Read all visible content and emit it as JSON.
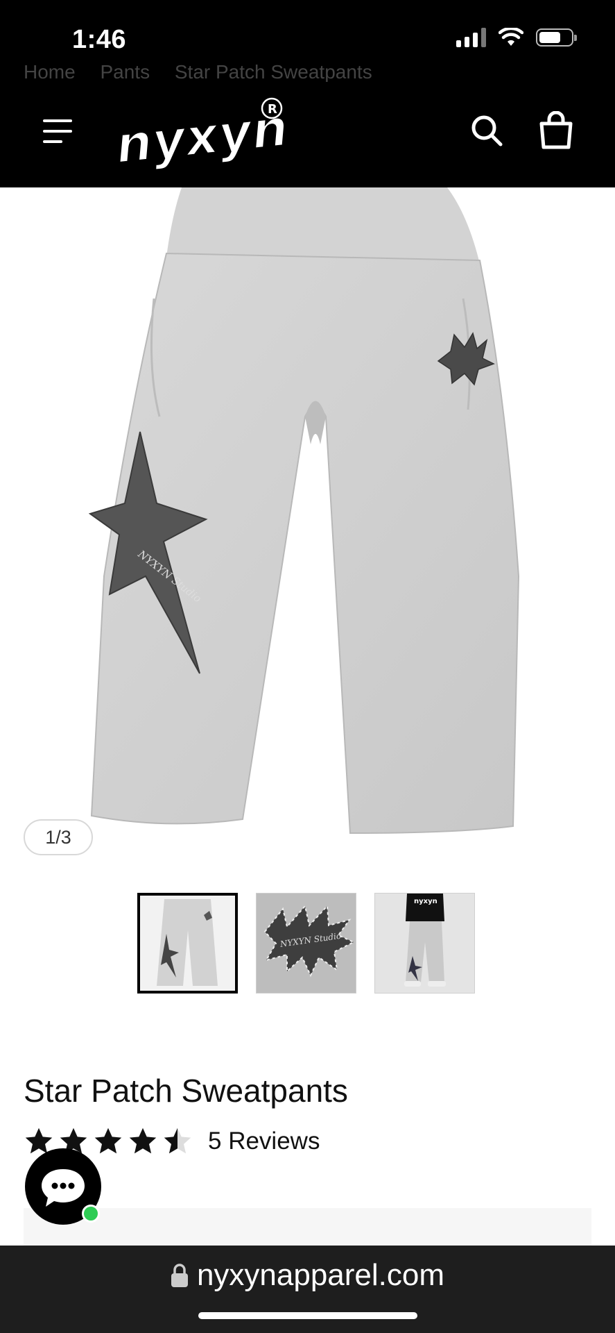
{
  "status_bar": {
    "time": "1:46"
  },
  "header": {
    "breadcrumb_partial": [
      "Home",
      "Pants",
      "Star Patch Sweatpants"
    ],
    "logo_text": "nyxyn",
    "logo_mark": "®",
    "icons": [
      "menu-icon",
      "search-icon",
      "shopping-bag-icon"
    ]
  },
  "gallery": {
    "counter": "1/3",
    "thumbnails": [
      {
        "label": "Sweatpants front view",
        "active": true
      },
      {
        "label": "Star patch close-up",
        "active": false
      },
      {
        "label": "Model wearing sweatpants",
        "active": false
      }
    ],
    "patch_text": "NYXYN Studio"
  },
  "product": {
    "title": "Star Patch Sweatpants",
    "rating": 4.5,
    "rating_max": 5,
    "reviews_label": "5 Reviews"
  },
  "chat": {
    "icon": "chat-bubble-icon",
    "online_color": "#2ecc54"
  },
  "browser": {
    "url": "nyxynapparel.com",
    "icon": "lock-icon"
  },
  "colors": {
    "header_bg": "#000000",
    "pants_gray": "#cfcfcf",
    "patch_gray": "#555555",
    "star_fill": "#111111"
  }
}
